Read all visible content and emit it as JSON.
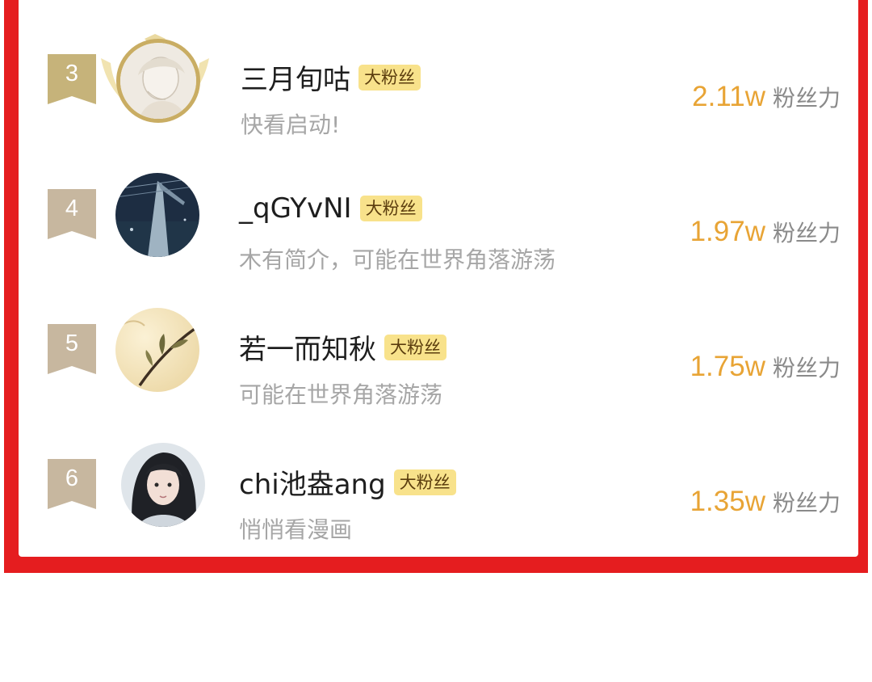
{
  "leaderboard": {
    "power_label": "粉丝力",
    "badge_label": "大粉丝",
    "rows": [
      {
        "rank": "3",
        "name": "三月旬咕",
        "badge": "大粉丝",
        "bio": "快看启动!",
        "value": "2.11w",
        "label": "粉丝力",
        "ribbon_color": "#c6b37a",
        "avatar": "sketch-portrait-icon"
      },
      {
        "rank": "4",
        "name": "_qGYvNI",
        "badge": "大粉丝",
        "bio": "木有简介，可能在世界角落游荡",
        "value": "1.97w",
        "label": "粉丝力",
        "ribbon_color": "#c7b79f",
        "avatar": "night-sky-icon"
      },
      {
        "rank": "5",
        "name": "若一而知秋",
        "badge": "大粉丝",
        "bio": "可能在世界角落游荡",
        "value": "1.75w",
        "label": "粉丝力",
        "ribbon_color": "#c7b79f",
        "avatar": "branch-leaves-icon"
      },
      {
        "rank": "6",
        "name": "chi池盎ang",
        "badge": "大粉丝",
        "bio": "悄悄看漫画",
        "value": "1.35w",
        "label": "粉丝力",
        "ribbon_color": "#c7b79f",
        "avatar": "anime-girl-icon"
      }
    ]
  },
  "colors": {
    "frame": "#e51d1f",
    "accent_value": "#e8a435",
    "badge_bg": "#f8e28b"
  }
}
